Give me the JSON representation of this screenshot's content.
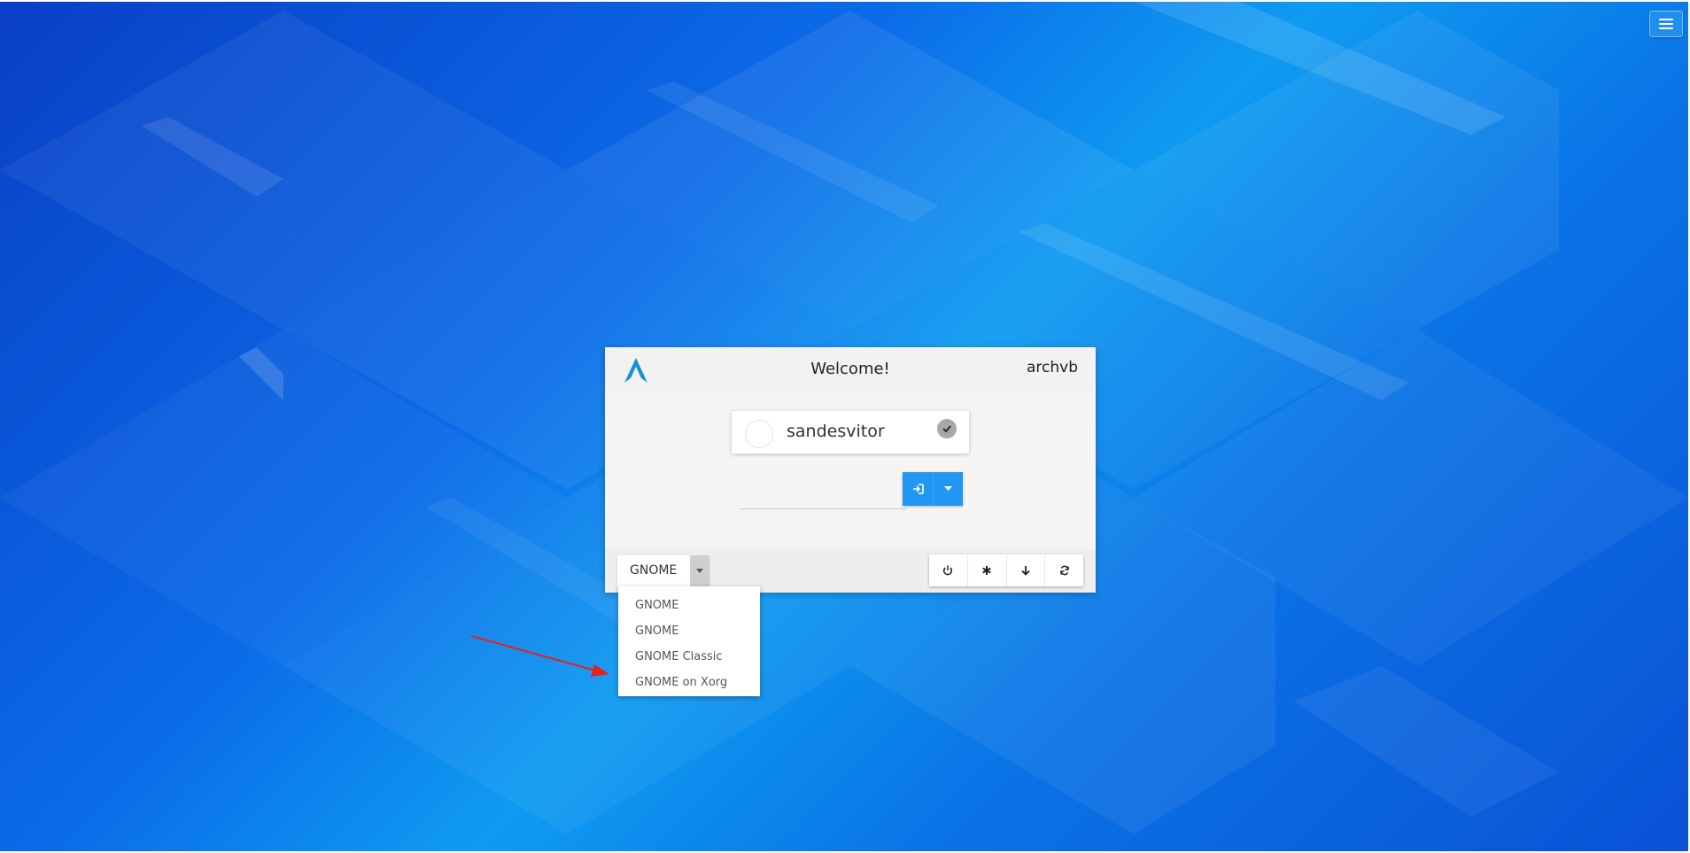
{
  "header": {
    "welcome": "Welcome!",
    "hostname": "archvb"
  },
  "user": {
    "name": "sandesvitor"
  },
  "password": {
    "value": "",
    "placeholder": ""
  },
  "session": {
    "selected": "GNOME",
    "options": [
      "GNOME",
      "GNOME",
      "GNOME Classic",
      "GNOME on Xorg"
    ]
  },
  "power_buttons": [
    "power-icon",
    "asterisk-icon",
    "arrow-down-icon",
    "refresh-icon"
  ],
  "colors": {
    "accent": "#2196f3",
    "annotation_arrow": "#e8201e"
  }
}
